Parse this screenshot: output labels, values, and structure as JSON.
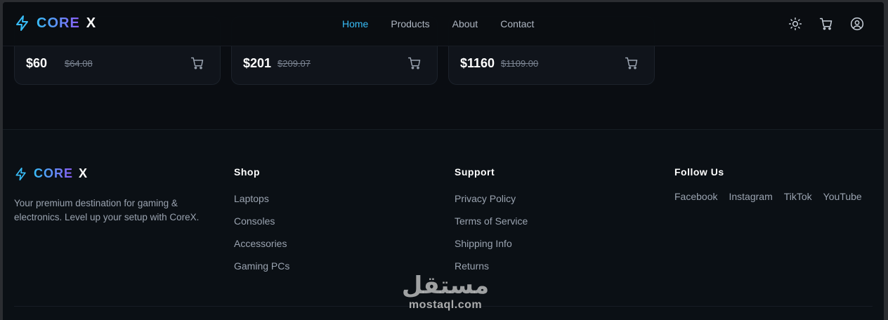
{
  "nav": {
    "brand_core": "CORE",
    "brand_x": "X",
    "links": [
      "Home",
      "Products",
      "About",
      "Contact"
    ],
    "active": "Home",
    "icons": [
      "sun-icon",
      "cart-icon",
      "user-icon"
    ]
  },
  "products": [
    {
      "price": "$60",
      "old_price": "$64.08"
    },
    {
      "price": "$201",
      "old_price": "$209.07"
    },
    {
      "price": "$1160",
      "old_price": "$1109.00"
    }
  ],
  "footer": {
    "brand_core": "CORE",
    "brand_x": "X",
    "description": "Your premium destination for gaming & electronics. Level up your setup with CoreX.",
    "shop": {
      "title": "Shop",
      "items": [
        "Laptops",
        "Consoles",
        "Accessories",
        "Gaming PCs"
      ]
    },
    "support": {
      "title": "Support",
      "items": [
        "Privacy Policy",
        "Terms of Service",
        "Shipping Info",
        "Returns"
      ]
    },
    "follow": {
      "title": "Follow Us",
      "items": [
        "Facebook",
        "Instagram",
        "TikTok",
        "YouTube"
      ]
    }
  },
  "watermark": {
    "arabic": "مستقل",
    "latin": "mostaql.com"
  },
  "colors": {
    "accent": "#38bdf8",
    "gradient_end": "#8b5cf6",
    "background": "#0a0d12"
  }
}
